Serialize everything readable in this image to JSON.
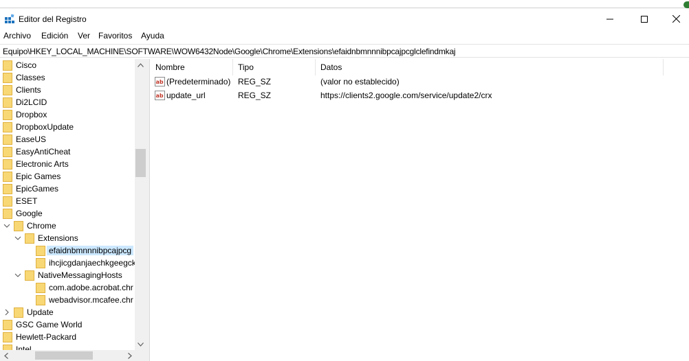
{
  "window": {
    "title": "Editor del Registro"
  },
  "menu": {
    "items": [
      "Archivo",
      "Edición",
      "Ver",
      "Favoritos",
      "Ayuda"
    ]
  },
  "address": {
    "path": "Equipo\\HKEY_LOCAL_MACHINE\\SOFTWARE\\WOW6432Node\\Google\\Chrome\\Extensions\\efaidnbmnnnibpcajpcglclefindmkaj"
  },
  "tree": {
    "items": [
      {
        "label": "Cisco",
        "level": 0,
        "expander": "none"
      },
      {
        "label": "Classes",
        "level": 0,
        "expander": "none"
      },
      {
        "label": "Clients",
        "level": 0,
        "expander": "none"
      },
      {
        "label": "Di2LCID",
        "level": 0,
        "expander": "none"
      },
      {
        "label": "Dropbox",
        "level": 0,
        "expander": "none"
      },
      {
        "label": "DropboxUpdate",
        "level": 0,
        "expander": "none"
      },
      {
        "label": "EaseUS",
        "level": 0,
        "expander": "none"
      },
      {
        "label": "EasyAntiCheat",
        "level": 0,
        "expander": "none"
      },
      {
        "label": "Electronic Arts",
        "level": 0,
        "expander": "none"
      },
      {
        "label": "Epic Games",
        "level": 0,
        "expander": "none"
      },
      {
        "label": "EpicGames",
        "level": 0,
        "expander": "none"
      },
      {
        "label": "ESET",
        "level": 0,
        "expander": "none"
      },
      {
        "label": "Google",
        "level": 0,
        "expander": "none"
      },
      {
        "label": "Chrome",
        "level": 1,
        "expander": "expanded"
      },
      {
        "label": "Extensions",
        "level": 2,
        "expander": "expanded"
      },
      {
        "label": "efaidnbmnnnibpcajpcg",
        "level": 3,
        "expander": "none",
        "selected": true
      },
      {
        "label": "ihcjicgdanjaechkgeegck",
        "level": 3,
        "expander": "none"
      },
      {
        "label": "NativeMessagingHosts",
        "level": 2,
        "expander": "expanded"
      },
      {
        "label": "com.adobe.acrobat.chr",
        "level": 3,
        "expander": "none"
      },
      {
        "label": "webadvisor.mcafee.chr",
        "level": 3,
        "expander": "none"
      },
      {
        "label": "Update",
        "level": 1,
        "expander": "collapsed"
      },
      {
        "label": "GSC Game World",
        "level": 0,
        "expander": "none"
      },
      {
        "label": "Hewlett-Packard",
        "level": 0,
        "expander": "none"
      },
      {
        "label": "Intel",
        "level": 0,
        "expander": "none"
      }
    ]
  },
  "list": {
    "columns": [
      "Nombre",
      "Tipo",
      "Datos"
    ],
    "rows": [
      {
        "name": "(Predeterminado)",
        "type": "REG_SZ",
        "data": "(valor no establecido)"
      },
      {
        "name": "update_url",
        "type": "REG_SZ",
        "data": "https://clients2.google.com/service/update2/crx"
      }
    ]
  },
  "colors": {
    "selection": "#cce8ff",
    "folder": "#f8d775",
    "folder_edge": "#e0b13f",
    "string_icon": "#c0392b"
  }
}
